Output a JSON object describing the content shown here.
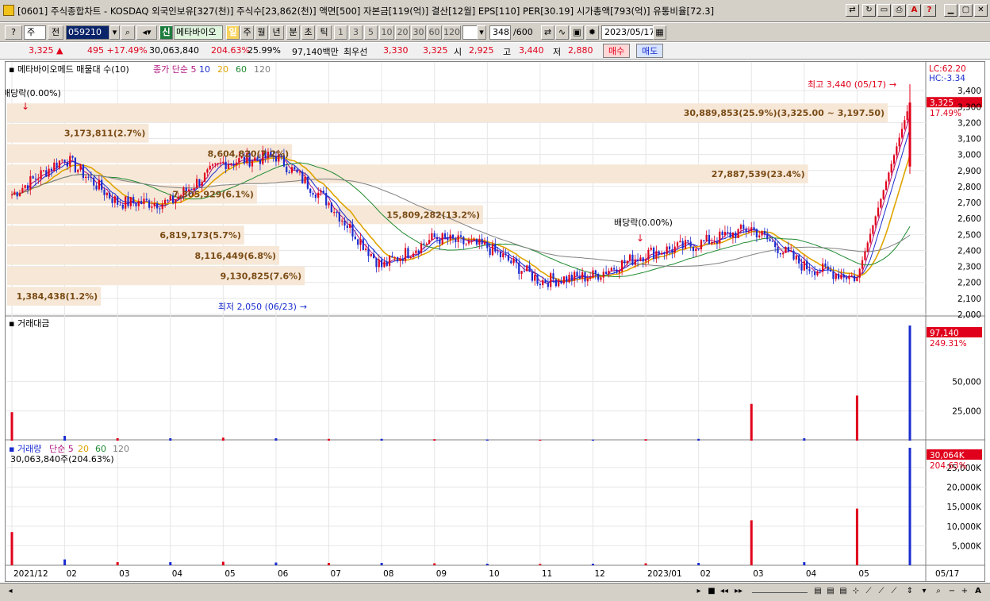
{
  "title": {
    "text": "[0601] 주식종합차트 - KOSDAQ 외국인보유[327(천)] 주식수[23,862(천)] 액면[500] 자본금[119(억)] 결산[12월] EPS[110] PER[30.19] 시가총액[793(억)] 유통비율[72.3]"
  },
  "toolbar": {
    "market": "주",
    "prev": "전",
    "code": "059210",
    "sin": "신",
    "name": "메타바이오",
    "day": "일",
    "week": "주",
    "month": "월",
    "year": "년",
    "minute": "분",
    "second": "초",
    "tick": "틱",
    "periods": [
      "1",
      "3",
      "5",
      "10",
      "20",
      "30",
      "60",
      "120"
    ],
    "count": "348",
    "count_total": "/600",
    "date": "2023/05/17"
  },
  "quote": {
    "price": "3,325 ▲",
    "change": "495 +17.49%",
    "volume": "30,063,840",
    "vol_ratio": "204.63%",
    "turnover": "25.99%",
    "amount": "97,140백만",
    "best_ask_label": "최우선",
    "ask": "3,330",
    "bid": "3,325",
    "open_label": "시",
    "open": "2,925",
    "high_label": "고",
    "high": "3,440",
    "low_label": "저",
    "low": "2,880",
    "buy": "매수",
    "sell": "매도"
  },
  "chart_data": [
    {
      "type": "candlestick",
      "title": "메타바이오메드 매물대 수(10)",
      "legend": [
        "종가 단순 5",
        "10",
        "20",
        "60",
        "120"
      ],
      "legend_colors": [
        "#b01780",
        "#1a2ccf",
        "#e0a400",
        "#1e8a30",
        "#808080"
      ],
      "ylim": [
        2000,
        3500
      ],
      "yticks": [
        2000,
        2100,
        2200,
        2300,
        2400,
        2500,
        2600,
        2700,
        2800,
        2900,
        3000,
        3100,
        3200,
        3300,
        3400
      ],
      "ytick_labels": [
        "2,000",
        "2,100",
        "2,200",
        "2,300",
        "2,400",
        "2,500",
        "2,600",
        "2,700",
        "2,800",
        "2,900",
        "3,000",
        "3,100",
        "3,200",
        "3,300",
        "3,400"
      ],
      "lc": "LC:62.20",
      "hc": "HC:-3.34",
      "last_price": "3,325",
      "last_change": "17.49%",
      "annotations": {
        "high": "최고 3,440 (05/17)",
        "low": "최저 2,050 (06/23)",
        "div1": "배당락(0.00%)",
        "div2": "배당락(0.00%)"
      },
      "profile": [
        {
          "price_from": 3197.5,
          "price_to": 3325,
          "label": "30,889,853(25.9%)(3,325.00 ~ 3,197.50)",
          "pct": 25.9
        },
        {
          "price_from": 3070,
          "price_to": 3197.5,
          "label": "3,173,811(2.7%)",
          "pct": 2.7
        },
        {
          "price_from": 2942.5,
          "price_to": 3070,
          "label": "8,604,820(7.2%)",
          "pct": 7.2
        },
        {
          "price_from": 2815,
          "price_to": 2942.5,
          "label": "27,887,539(23.4%)",
          "pct": 23.4
        },
        {
          "price_from": 2687.5,
          "price_to": 2815,
          "label": "7,305,929(6.1%)",
          "pct": 6.1
        },
        {
          "price_from": 2560,
          "price_to": 2687.5,
          "label": "15,809,282(13.2%)",
          "pct": 13.2
        },
        {
          "price_from": 2432.5,
          "price_to": 2560,
          "label": "6,819,173(5.7%)",
          "pct": 5.7
        },
        {
          "price_from": 2305,
          "price_to": 2432.5,
          "label": "8,116,449(6.8%)",
          "pct": 6.8
        },
        {
          "price_from": 2177.5,
          "price_to": 2305,
          "label": "9,130,825(7.6%)",
          "pct": 7.6
        },
        {
          "price_from": 2050,
          "price_to": 2177.5,
          "label": "1,384,438(1.2%)",
          "pct": 1.2
        }
      ],
      "x": [
        "2021/12",
        "2022/02",
        "2022/03",
        "2022/04",
        "2022/05",
        "2022/06",
        "2022/07",
        "2022/08",
        "2022/09",
        "2022/10",
        "2022/11",
        "2022/12",
        "2023/01",
        "2023/02",
        "2023/03",
        "2023/04",
        "2023/05",
        "2023/05/17"
      ],
      "x_labels": [
        "2021/12",
        "02",
        "03",
        "04",
        "05",
        "06",
        "07",
        "08",
        "09",
        "10",
        "11",
        "12",
        "2023/01",
        "02",
        "03",
        "04",
        "05",
        "05/17"
      ],
      "close": [
        2750,
        2980,
        2700,
        2700,
        2950,
        2990,
        2700,
        2300,
        2480,
        2420,
        2210,
        2240,
        2380,
        2440,
        2540,
        2300,
        2230,
        3325
      ]
    },
    {
      "type": "bar",
      "title": "거래대금",
      "yticks": [
        25000,
        50000
      ],
      "ytick_labels": [
        "25,000",
        "50,000"
      ],
      "last_value": "97,140",
      "last_pct": "249.31%",
      "x": [
        "2021/12",
        "2022/02",
        "2022/03",
        "2022/04",
        "2022/05",
        "2022/06",
        "2022/07",
        "2022/08",
        "2022/09",
        "2022/10",
        "2022/11",
        "2022/12",
        "2023/01",
        "2023/02",
        "2023/03",
        "2023/04",
        "2023/05",
        "2023/05/17"
      ],
      "values": [
        24000,
        4000,
        2000,
        2000,
        2500,
        2000,
        1500,
        1500,
        1200,
        1000,
        800,
        900,
        1200,
        1500,
        31000,
        2000,
        38000,
        97140
      ]
    },
    {
      "type": "bar",
      "title": "거래량",
      "legend": [
        "단순 5",
        "20",
        "60",
        "120"
      ],
      "legend_colors": [
        "#b01780",
        "#e0a400",
        "#1e8a30",
        "#808080"
      ],
      "subtitle": "30,063,840주(204.63%)",
      "yticks": [
        5000,
        10000,
        15000,
        20000,
        25000
      ],
      "ytick_labels": [
        "5,000K",
        "10,000K",
        "15,000K",
        "20,000K",
        "25,000K"
      ],
      "last_value": "30,064K",
      "last_pct": "204.63%",
      "x": [
        "2021/12",
        "2022/02",
        "2022/03",
        "2022/04",
        "2022/05",
        "2022/06",
        "2022/07",
        "2022/08",
        "2022/09",
        "2022/10",
        "2022/11",
        "2022/12",
        "2023/01",
        "2023/02",
        "2023/03",
        "2023/04",
        "2023/05",
        "2023/05/17"
      ],
      "values": [
        8500,
        1500,
        800,
        800,
        900,
        700,
        600,
        600,
        500,
        400,
        350,
        400,
        500,
        600,
        11500,
        800,
        14500,
        30064
      ]
    }
  ]
}
